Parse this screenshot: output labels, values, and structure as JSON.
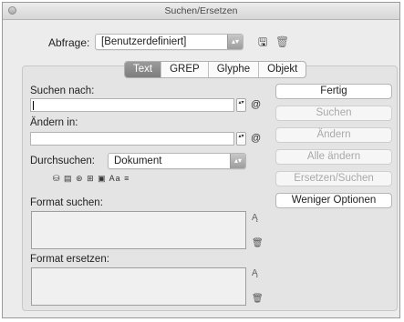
{
  "window": {
    "title": "Suchen/Ersetzen"
  },
  "query": {
    "label": "Abfrage:",
    "value": "[Benutzerdefiniert]"
  },
  "tabs": [
    {
      "label": "Text",
      "active": true
    },
    {
      "label": "GREP",
      "active": false
    },
    {
      "label": "Glyphe",
      "active": false
    },
    {
      "label": "Objekt",
      "active": false
    }
  ],
  "find": {
    "label": "Suchen nach:",
    "value": ""
  },
  "change": {
    "label": "Ändern in:",
    "value": ""
  },
  "search_in": {
    "label": "Durchsuchen:",
    "value": "Dokument"
  },
  "option_icons": "⛁ ▤  ⊛ ⊞ ▣   Aa ≡",
  "buttons": {
    "done": "Fertig",
    "find": "Suchen",
    "change": "Ändern",
    "change_all": "Alle ändern",
    "change_find": "Ersetzen/Suchen",
    "fewer_options": "Weniger Optionen"
  },
  "format_find": {
    "label": "Format suchen:"
  },
  "format_change": {
    "label": "Format ersetzen:"
  },
  "icons": {
    "save": "🖫",
    "trash": "🗑",
    "special_char": "@",
    "format_spec": "Ą",
    "clear": "🗑",
    "stepper": "▴▾"
  },
  "colors": {
    "active_tab": "#8a8a8a",
    "disabled_text": "#a9a9a9"
  }
}
